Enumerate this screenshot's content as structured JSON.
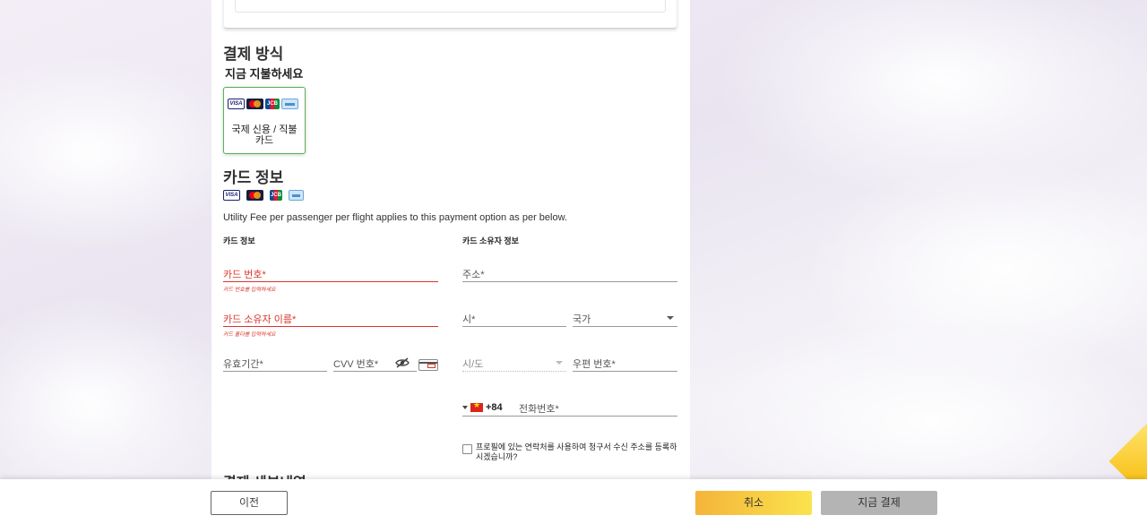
{
  "payment_method": {
    "heading": "결제 방식",
    "pay_now": "지금 지불하세요",
    "option_label": "국제 신용 / 직불 카드"
  },
  "card_info": {
    "heading": "카드 정보",
    "notice": "Utility Fee per passenger per flight applies to this payment option as per below.",
    "left_column_title": "카드 정보",
    "right_column_title": "카드 소유자 정보",
    "card_number": {
      "placeholder": "카드 번호*",
      "error": "카드 번호를 입력하세요"
    },
    "holder_name": {
      "placeholder": "카드 소유자 이름*",
      "error": "카드 홀더를 입력하세요"
    },
    "expiry": {
      "placeholder": "유효기간*"
    },
    "cvv": {
      "placeholder": "CVV 번호*"
    }
  },
  "holder_info": {
    "address": {
      "placeholder": "주소*"
    },
    "city": {
      "placeholder": "시*"
    },
    "country": {
      "placeholder": "국가"
    },
    "state": {
      "placeholder": "시/도"
    },
    "postal_code": {
      "placeholder": "우편 번호*"
    },
    "phone": {
      "country_code": "+84",
      "placeholder": "전화번호*"
    },
    "use_profile_contact": "프로필에 있는 연락처를 사용하여 청구서 수신 주소를 등록하시겠습니까?"
  },
  "next_section_heading": "결제 세부내역",
  "footer": {
    "prev": "이전",
    "cancel": "취소",
    "pay_now": "지금 결제"
  },
  "colors": {
    "error": "#d9352b",
    "selected_border": "#58b058",
    "cancel_button": "#f4b43a",
    "pay_button_disabled": "#b4b4b4"
  },
  "icons": [
    "visa-logo",
    "mastercard-logo",
    "jcb-logo",
    "amex-logo",
    "eye-slash-icon",
    "cvv-card-icon",
    "vietnam-flag-icon",
    "chevron-down-icon"
  ]
}
